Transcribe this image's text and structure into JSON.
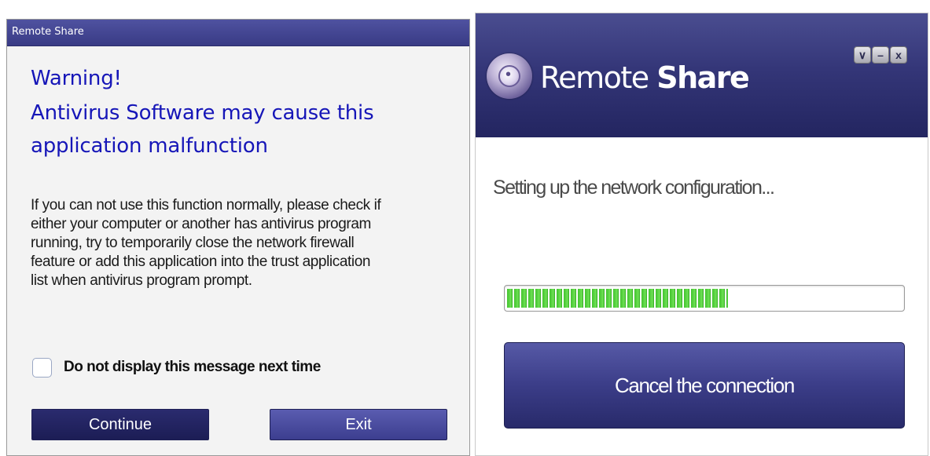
{
  "left_dialog": {
    "title": "Remote Share",
    "warning_lines": [
      "Warning!",
      "Antivirus Software may cause this",
      "application malfunction"
    ],
    "body_lines": [
      "If you can not use this function normally, please check if",
      "either your computer or another has antivirus program",
      "running, try to temporarily close the network firewall",
      "feature or add this application into the trust application",
      "list when antivirus program prompt."
    ],
    "checkbox_label": "Do not display this message next time",
    "checkbox_checked": false,
    "continue_label": "Continue",
    "exit_label": "Exit"
  },
  "right_window": {
    "title_regular": "Remote ",
    "title_bold": "Share",
    "menu_glyph": "∨",
    "minimize_glyph": "–",
    "close_glyph": "x",
    "status_text": "Setting up the network configuration...",
    "progress_fraction": 0.56,
    "cancel_label": "Cancel the connection"
  },
  "colors": {
    "warning_text": "#1616b8",
    "title_bar": "#3e4190",
    "progress_green": "#42c22e"
  },
  "icons": [
    "remote-share-logo-icon",
    "chevron-down-icon",
    "minimize-icon",
    "close-icon"
  ]
}
